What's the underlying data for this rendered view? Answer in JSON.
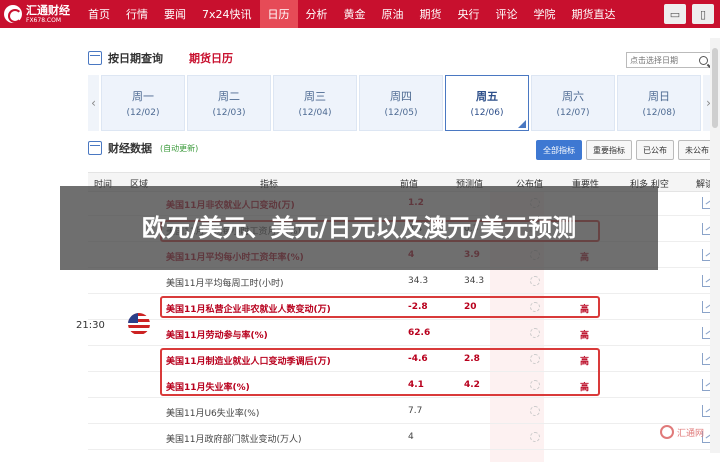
{
  "logo": {
    "cn": "汇通财经",
    "en": "FX678.COM"
  },
  "nav": [
    "首页",
    "行情",
    "要闻",
    "7x24快讯",
    "日历",
    "分析",
    "黄金",
    "原油",
    "期货",
    "央行",
    "评论",
    "学院",
    "期货直达"
  ],
  "nav_active": 4,
  "section": {
    "title": "按日期查询",
    "subtitle": "期货日历",
    "search_placeholder": "点击选择日期"
  },
  "days": [
    {
      "name": "周一",
      "date": "(12/02)"
    },
    {
      "name": "周二",
      "date": "(12/03)"
    },
    {
      "name": "周三",
      "date": "(12/04)"
    },
    {
      "name": "周四",
      "date": "(12/05)"
    },
    {
      "name": "周五",
      "date": "(12/06)"
    },
    {
      "name": "周六",
      "date": "(12/07)"
    },
    {
      "name": "周日",
      "date": "(12/08)"
    }
  ],
  "active_day": 4,
  "fin": {
    "title": "财经数据",
    "auto": "(自动更新)"
  },
  "filters": [
    "全部指标",
    "重要指标",
    "已公布",
    "未公布"
  ],
  "columns": {
    "time": "时间",
    "region": "区域",
    "indicator": "指标",
    "prev": "前值",
    "forecast": "预测值",
    "published": "公布值",
    "importance": "重要性",
    "bullish": "利多 利空",
    "read": "解读"
  },
  "group_time": "21:30",
  "rows": [
    {
      "name": "美国11月非农就业人口变动(万)",
      "prev": "1.2",
      "forecast": "",
      "imp": "",
      "hl": true
    },
    {
      "name": "美国11月平均每小时工资月率(%)",
      "prev": "0.4",
      "forecast": "0.3",
      "imp": "",
      "hl": false
    },
    {
      "name": "美国11月平均每小时工资年率(%)",
      "prev": "4",
      "forecast": "3.9",
      "imp": "高",
      "hl": true
    },
    {
      "name": "美国11月平均每周工时(小时)",
      "prev": "34.3",
      "forecast": "34.3",
      "imp": "",
      "hl": false
    },
    {
      "name": "美国11月私营企业非农就业人数变动(万)",
      "prev": "-2.8",
      "forecast": "20",
      "imp": "高",
      "hl": true
    },
    {
      "name": "美国11月劳动参与率(%)",
      "prev": "62.6",
      "forecast": "",
      "imp": "高",
      "hl": true
    },
    {
      "name": "美国11月制造业就业人口变动季调后(万)",
      "prev": "-4.6",
      "forecast": "2.8",
      "imp": "高",
      "hl": true
    },
    {
      "name": "美国11月失业率(%)",
      "prev": "4.1",
      "forecast": "4.2",
      "imp": "高",
      "hl": true
    },
    {
      "name": "美国11月U6失业率(%)",
      "prev": "7.7",
      "forecast": "",
      "imp": "",
      "hl": false
    },
    {
      "name": "美国11月政府部门就业变动(万人)",
      "prev": "4",
      "forecast": "",
      "imp": "",
      "hl": false
    }
  ],
  "overlay": "欧元/美元、美元/日元以及澳元/美元预测",
  "watermark": "汇通网"
}
